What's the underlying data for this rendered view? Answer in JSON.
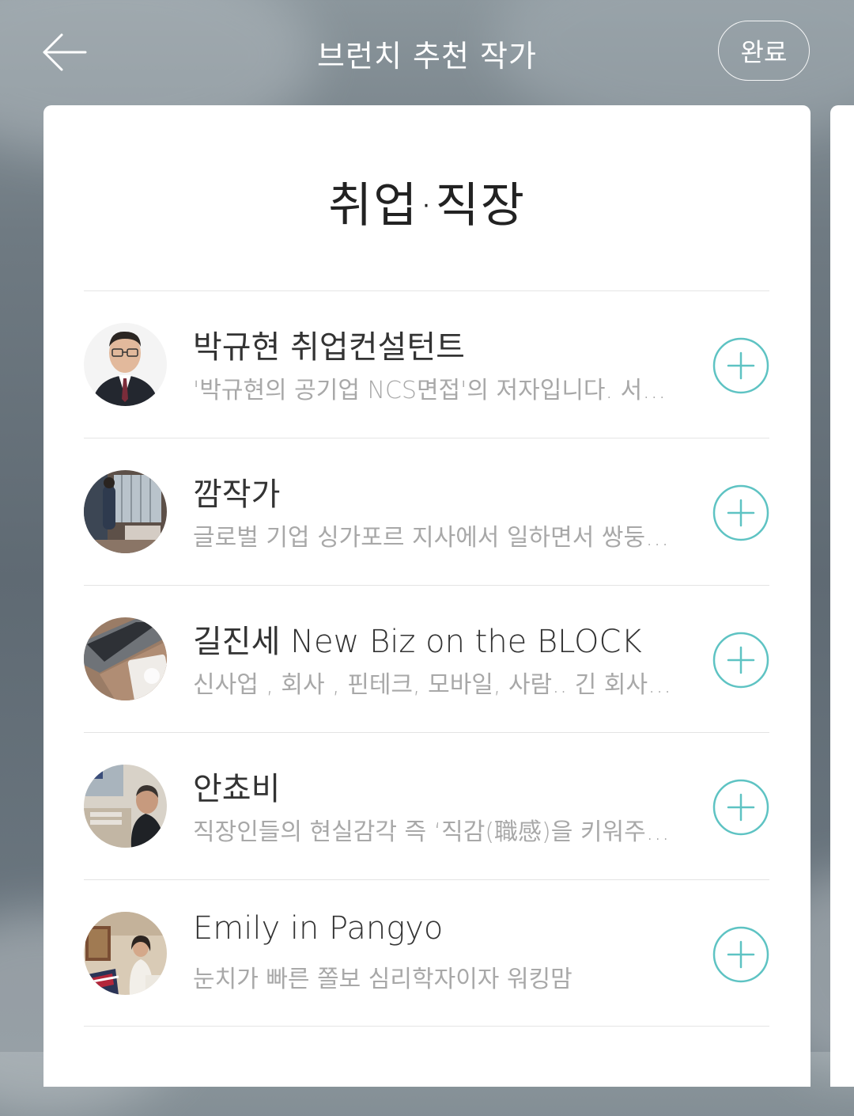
{
  "header": {
    "title": "브런치 추천 작가",
    "done_label": "완료"
  },
  "category": {
    "title": "취업·직장"
  },
  "writers": [
    {
      "name": "박규현 취업컨설턴트",
      "description": "'박규현의 공기업 NCS면접'의 저자입니다. 서…"
    },
    {
      "name": "깜작가",
      "description": "글로벌 기업 싱가포르 지사에서 일하면서 쌍둥…"
    },
    {
      "name": "길진세 New Biz on the BLOCK",
      "description": "신사업 , 회사 , 핀테크, 모바일, 사람.. 긴 회사…"
    },
    {
      "name": "안쵸비",
      "description": "직장인들의 현실감각 즉 ‘직감(職感)을 키워주…"
    },
    {
      "name": "Emily in Pangyo",
      "description": "눈치가 빠른 쫄보 심리학자이자 워킹맘"
    }
  ],
  "colors": {
    "accent": "#5ec3c3",
    "name_text": "#333333",
    "desc_text": "#a8a8a8"
  },
  "icons": {
    "back": "arrow-left-icon",
    "add": "plus-circle-icon"
  }
}
